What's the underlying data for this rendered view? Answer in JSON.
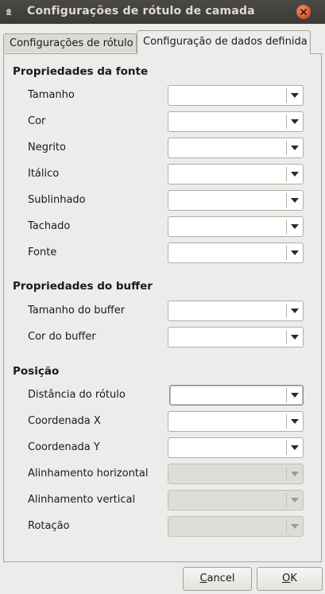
{
  "window": {
    "title": "Configurações de rótulo de camada",
    "icons": {
      "menu": "window-menu-icon",
      "close": "close-icon"
    }
  },
  "tabs": [
    {
      "label": "Configurações de rótulo",
      "active": false
    },
    {
      "label": "Configuração de dados definida",
      "active": true
    }
  ],
  "sections": {
    "font": {
      "title": "Propriedades da fonte",
      "rows": [
        {
          "label": "Tamanho",
          "value": "",
          "enabled": true
        },
        {
          "label": "Cor",
          "value": "",
          "enabled": true
        },
        {
          "label": "Negrito",
          "value": "",
          "enabled": true
        },
        {
          "label": "Itálico",
          "value": "",
          "enabled": true
        },
        {
          "label": "Sublinhado",
          "value": "",
          "enabled": true
        },
        {
          "label": "Tachado",
          "value": "",
          "enabled": true
        },
        {
          "label": "Fonte",
          "value": "",
          "enabled": true
        }
      ]
    },
    "buffer": {
      "title": "Propriedades do buffer",
      "rows": [
        {
          "label": "Tamanho do buffer",
          "value": "",
          "enabled": true
        },
        {
          "label": "Cor do buffer",
          "value": "",
          "enabled": true
        }
      ]
    },
    "position": {
      "title": "Posição",
      "rows": [
        {
          "label": "Distância do rótulo",
          "value": "",
          "enabled": true,
          "focused": true
        },
        {
          "label": "Coordenada X",
          "value": "",
          "enabled": true
        },
        {
          "label": "Coordenada Y",
          "value": "",
          "enabled": true
        },
        {
          "label": "Alinhamento horizontal",
          "value": "",
          "enabled": false
        },
        {
          "label": "Alinhamento vertical",
          "value": "",
          "enabled": false
        },
        {
          "label": "Rotação",
          "value": "",
          "enabled": false
        }
      ]
    }
  },
  "buttons": {
    "cancel": {
      "mnemonic": "C",
      "rest": "ancel"
    },
    "ok": {
      "mnemonic": "O",
      "rest": "K"
    }
  },
  "colors": {
    "titlebar": "#3b3a36",
    "close_button": "#e05a2a",
    "background": "#edeceb"
  }
}
